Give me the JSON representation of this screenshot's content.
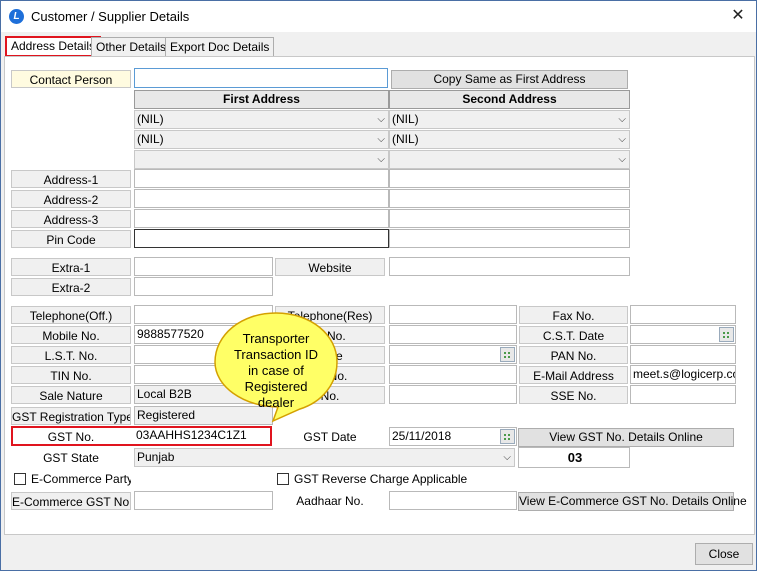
{
  "window": {
    "title": "Customer / Supplier Details",
    "close_glyph": "✕",
    "app_icon": "L"
  },
  "tabs": [
    {
      "label": "Address Details",
      "active": true
    },
    {
      "label": "Other Details",
      "active": false
    },
    {
      "label": "Export Doc Details",
      "active": false
    }
  ],
  "contact": {
    "label": "Contact Person",
    "value": "",
    "copy_button": "Copy Same as First Address"
  },
  "address_columns": {
    "first": "First Address",
    "second": "Second Address"
  },
  "address_dropdowns": {
    "first": [
      "(NIL)",
      "(NIL)",
      ""
    ],
    "second": [
      "(NIL)",
      "(NIL)",
      ""
    ]
  },
  "address_rows": [
    {
      "label": "Address-1"
    },
    {
      "label": "Address-2"
    },
    {
      "label": "Address-3"
    },
    {
      "label": "Pin Code"
    }
  ],
  "extra": {
    "extra1_label": "Extra-1",
    "extra2_label": "Extra-2",
    "website_label": "Website"
  },
  "contact_info": {
    "telephone_off_label": "Telephone(Off.)",
    "telephone_res_label": "Telephone(Res)",
    "fax_label": "Fax No.",
    "mobile_label": "Mobile No.",
    "mobile_value": "9888577520",
    "cst_no_label": "C.S.T. No.",
    "cst_no_visible": "T. No.",
    "cst_date_label": "C.S.T. Date",
    "lst_no_label": "L.S.T. No.",
    "lst_date_visible": "Date",
    "pan_label": "PAN No.",
    "tin_label": "TIN No.",
    "tax_no_visible": "ax No.",
    "email_label": "E-Mail Address",
    "email_value": "meet.s@logicerp.com",
    "sale_nature_label": "Sale Nature",
    "sale_nature_value": "Local B2B",
    "misc_no_visible": "No.",
    "sse_label": "SSE No."
  },
  "gst": {
    "reg_type_label": "GST Registration Type",
    "reg_type_value": "Registered",
    "gst_no_label": "GST No.",
    "gst_no_value": "03AAHHS1234C1Z1",
    "gst_date_label": "GST Date",
    "gst_date_value": "25/11/2018",
    "view_online_button": "View GST No. Details Online",
    "state_label": "GST State",
    "state_value": "Punjab",
    "state_code": "03"
  },
  "ecommerce": {
    "party_label": "E-Commerce Party",
    "reverse_charge_label": "GST Reverse Charge Applicable",
    "gst_no_label": "E-Commerce GST No.",
    "aadhaar_label": "Aadhaar No.",
    "view_online_button": "View E-Commerce GST No. Details Online"
  },
  "callout": {
    "lines": [
      "Transporter",
      "Transaction ID",
      "in case of",
      "Registered",
      "dealer"
    ],
    "fill": "#ffff66",
    "stroke": "#d4a000"
  },
  "footer": {
    "close_button": "Close"
  },
  "colors": {
    "highlight": "#e0141e",
    "focus": "#5b9bd5"
  }
}
